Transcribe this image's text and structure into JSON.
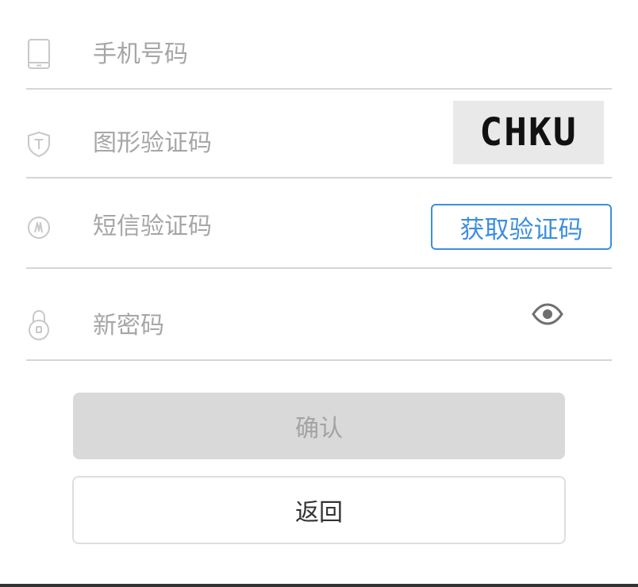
{
  "form": {
    "phone": {
      "icon": "phone-icon",
      "placeholder": "手机号码",
      "value": ""
    },
    "captcha": {
      "icon": "shield-icon",
      "placeholder": "图形验证码",
      "value": "",
      "image_text": "CHKU"
    },
    "sms": {
      "icon": "message-code-icon",
      "placeholder": "短信验证码",
      "value": "",
      "button_label": "获取验证码"
    },
    "password": {
      "icon": "lock-icon",
      "placeholder": "新密码",
      "value": "",
      "toggle_icon": "eye-icon"
    }
  },
  "actions": {
    "confirm_label": "确认",
    "back_label": "返回"
  },
  "colors": {
    "accent": "#3d8ee0",
    "disabled_bg": "#d9d9d9",
    "disabled_text": "#a3a3a3",
    "divider": "#d6d6d6",
    "placeholder": "#a6a6a6"
  }
}
